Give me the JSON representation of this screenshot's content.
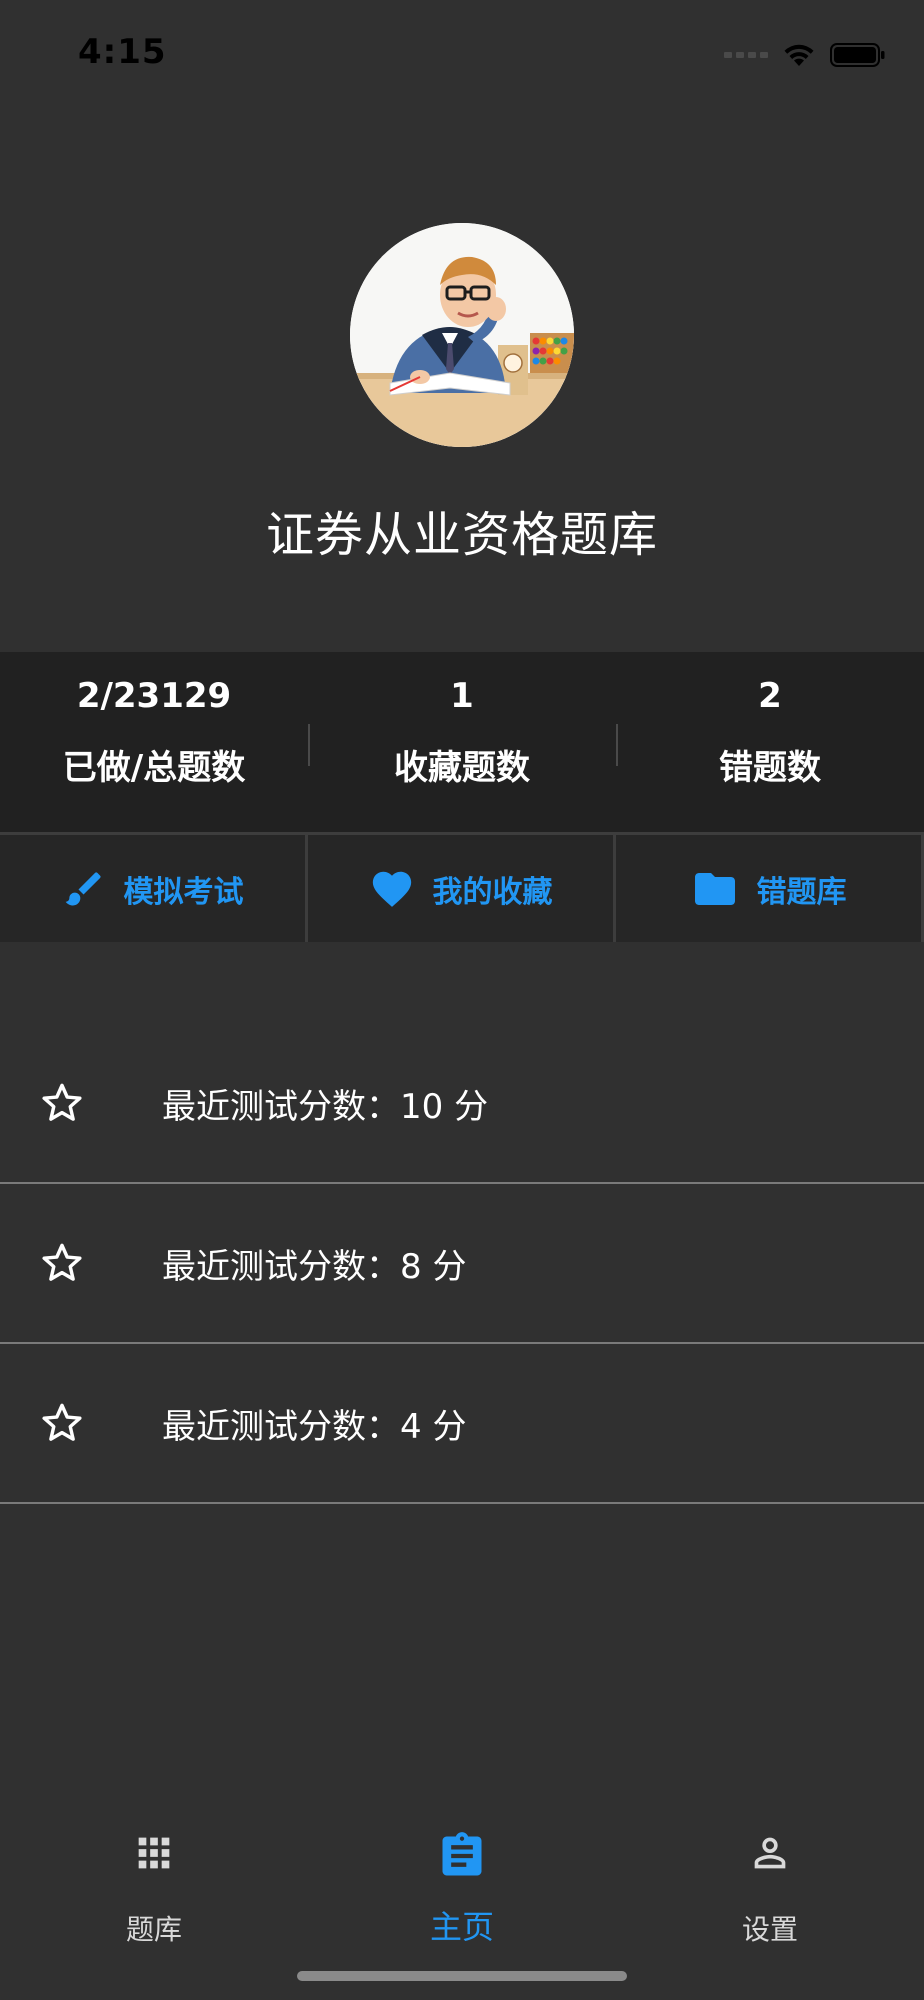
{
  "status_bar": {
    "time": "4:15"
  },
  "profile": {
    "title": "证券从业资格题库",
    "avatar_icon": "student-avatar"
  },
  "stats": [
    {
      "value": "2/23129",
      "label": "已做/总题数"
    },
    {
      "value": "1",
      "label": "收藏题数"
    },
    {
      "value": "2",
      "label": "错题数"
    }
  ],
  "actions": [
    {
      "label": "模拟考试",
      "icon": "brush-icon"
    },
    {
      "label": "我的收藏",
      "icon": "heart-icon"
    },
    {
      "label": "错题库",
      "icon": "folder-icon"
    }
  ],
  "scores": [
    {
      "text": "最近测试分数：10 分"
    },
    {
      "text": "最近测试分数：8 分"
    },
    {
      "text": "最近测试分数：4 分"
    }
  ],
  "bottom_nav": [
    {
      "label": "题库",
      "icon": "grid-icon",
      "active": false
    },
    {
      "label": "主页",
      "icon": "clipboard-icon",
      "active": true
    },
    {
      "label": "设置",
      "icon": "person-icon",
      "active": false
    }
  ],
  "colors": {
    "background": "#303030",
    "stats_background": "#212121",
    "accent": "#2196f3",
    "divider": "#7a7a7a"
  }
}
